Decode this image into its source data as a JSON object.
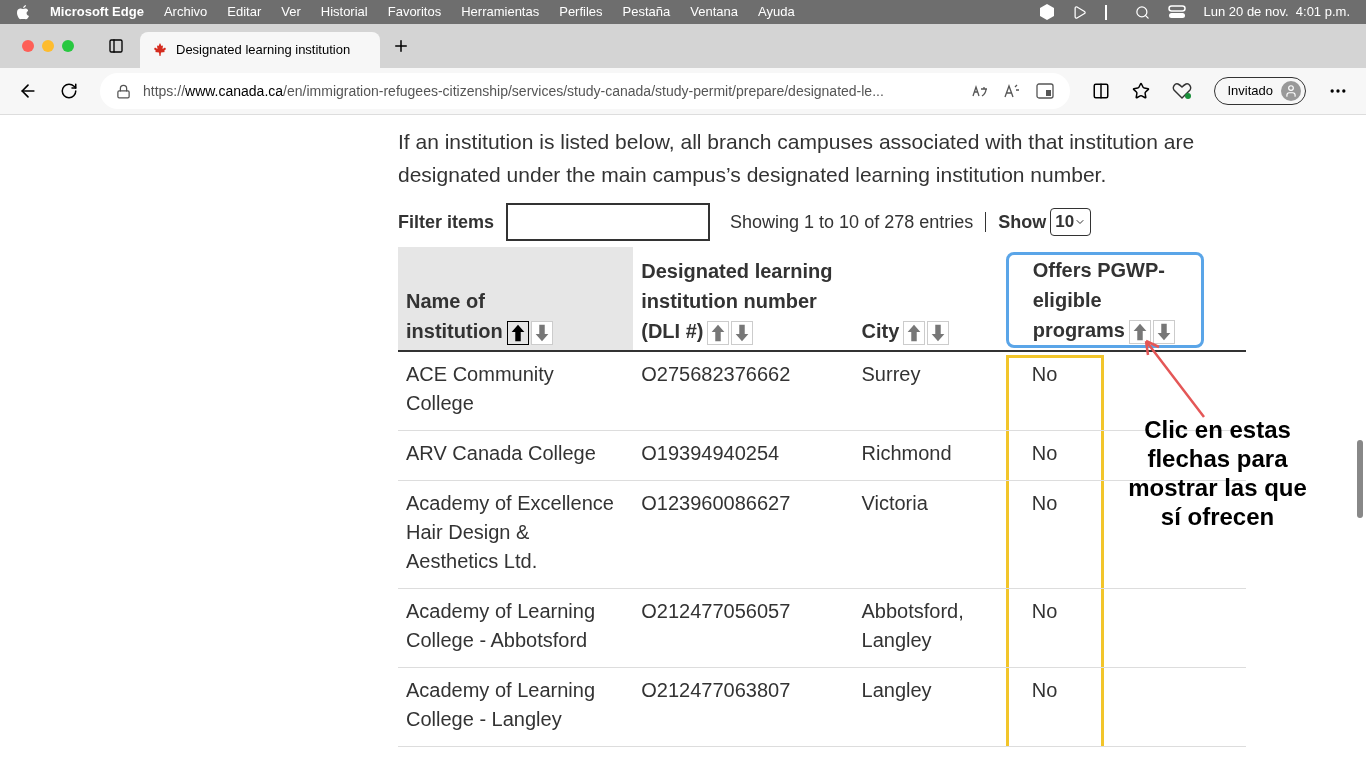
{
  "menu_bar": {
    "app": "Microsoft Edge",
    "items": [
      "Archivo",
      "Editar",
      "Ver",
      "Historial",
      "Favoritos",
      "Herramientas",
      "Perfiles",
      "Pestaña",
      "Ventana",
      "Ayuda"
    ],
    "clock": "Lun 20 de nov.  4:01 p.m."
  },
  "tab": {
    "title": "Designated learning institution",
    "selected": true
  },
  "address": {
    "prefix": "https://",
    "domain": "www.canada.ca",
    "path": "/en/immigration-refugees-citizenship/services/study-canada/study-permit/prepare/designated-le..."
  },
  "profile": {
    "label": "Invitado"
  },
  "intro": "If an institution is listed below, all branch campuses associated with that institution are designated under the main campus’s designated learning institution number.",
  "filter": {
    "label": "Filter items"
  },
  "info": "Showing 1 to 10 of 278 entries",
  "show": {
    "label": "Show",
    "value": "10"
  },
  "table": {
    "columns": [
      {
        "label": "Name of institution",
        "sorted": true
      },
      {
        "label": "Designated learning institution number (DLI #)",
        "sorted": false
      },
      {
        "label": "City",
        "sorted": false
      },
      {
        "label": "Offers PGWP-eligible programs",
        "sorted": false
      }
    ],
    "rows": [
      [
        "ACE Community College",
        "O275682376662",
        "Surrey",
        "No"
      ],
      [
        "ARV Canada College",
        "O19394940254",
        "Richmond",
        "No"
      ],
      [
        "Academy of Excellence Hair Design & Aesthetics Ltd.",
        "O123960086627",
        "Victoria",
        "No"
      ],
      [
        "Academy of Learning College - Abbotsford",
        "O212477056057",
        "Abbotsford, Langley",
        "No"
      ],
      [
        "Academy of Learning College - Langley",
        "O212477063807",
        "Langley",
        "No"
      ]
    ]
  },
  "annotation": {
    "text": "Clic en estas flechas para mostrar las que sí ofrecen"
  }
}
